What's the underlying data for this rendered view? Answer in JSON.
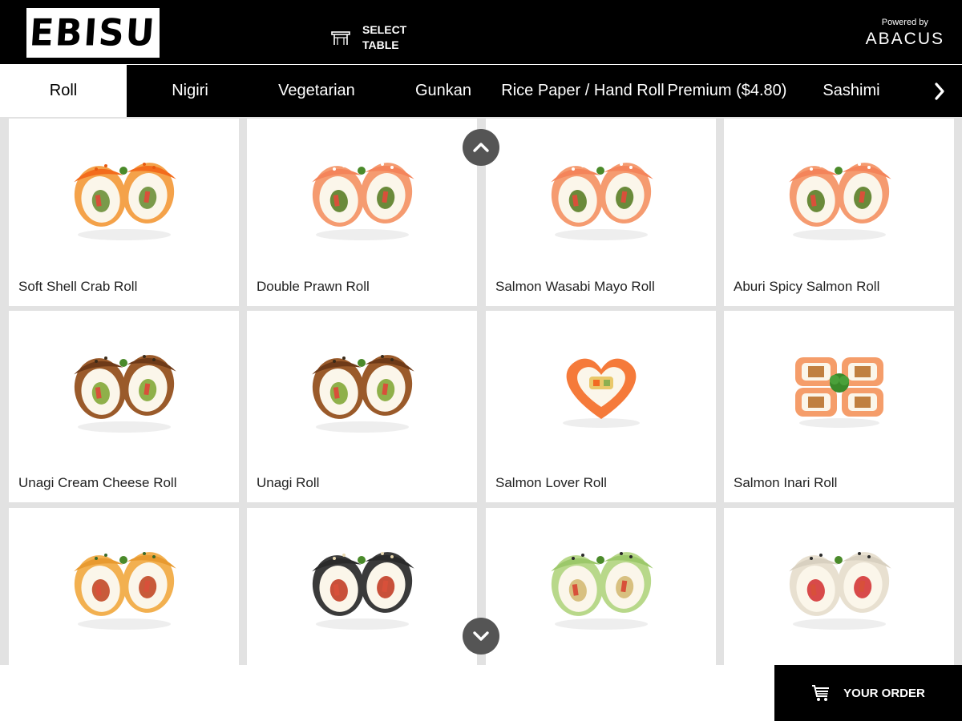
{
  "header": {
    "logo": "EBISU",
    "select_table": "SELECT TABLE",
    "powered_by": "Powered by",
    "powered_brand": "ABACUS"
  },
  "tabs": [
    {
      "label": "Roll",
      "active": true
    },
    {
      "label": "Nigiri",
      "active": false
    },
    {
      "label": "Vegetarian",
      "active": false
    },
    {
      "label": "Gunkan",
      "active": false
    },
    {
      "label": "Rice Paper / Hand Roll",
      "active": false
    },
    {
      "label": "Premium ($4.80)",
      "active": false
    },
    {
      "label": "Sashimi",
      "active": false
    }
  ],
  "items": [
    {
      "name": "Soft Shell Crab Roll",
      "style": "roe"
    },
    {
      "name": "Double Prawn Roll",
      "style": "salmon-top"
    },
    {
      "name": "Salmon Wasabi Mayo Roll",
      "style": "salmon-top"
    },
    {
      "name": "Aburi Spicy Salmon Roll",
      "style": "salmon-top"
    },
    {
      "name": "Unagi Cream Cheese Roll",
      "style": "eel"
    },
    {
      "name": "Unagi Roll",
      "style": "eel"
    },
    {
      "name": "Salmon Lover Roll",
      "style": "heart"
    },
    {
      "name": "Salmon Inari Roll",
      "style": "inari"
    },
    {
      "name": "",
      "style": "torched"
    },
    {
      "name": "",
      "style": "sesame"
    },
    {
      "name": "",
      "style": "avocado"
    },
    {
      "name": "",
      "style": "sesame-white"
    }
  ],
  "footer": {
    "order_label": "YOUR ORDER"
  },
  "colors": {
    "header_bg": "#000000",
    "grid_bg": "#e2e2e2",
    "scroll_btn": "#555555"
  }
}
